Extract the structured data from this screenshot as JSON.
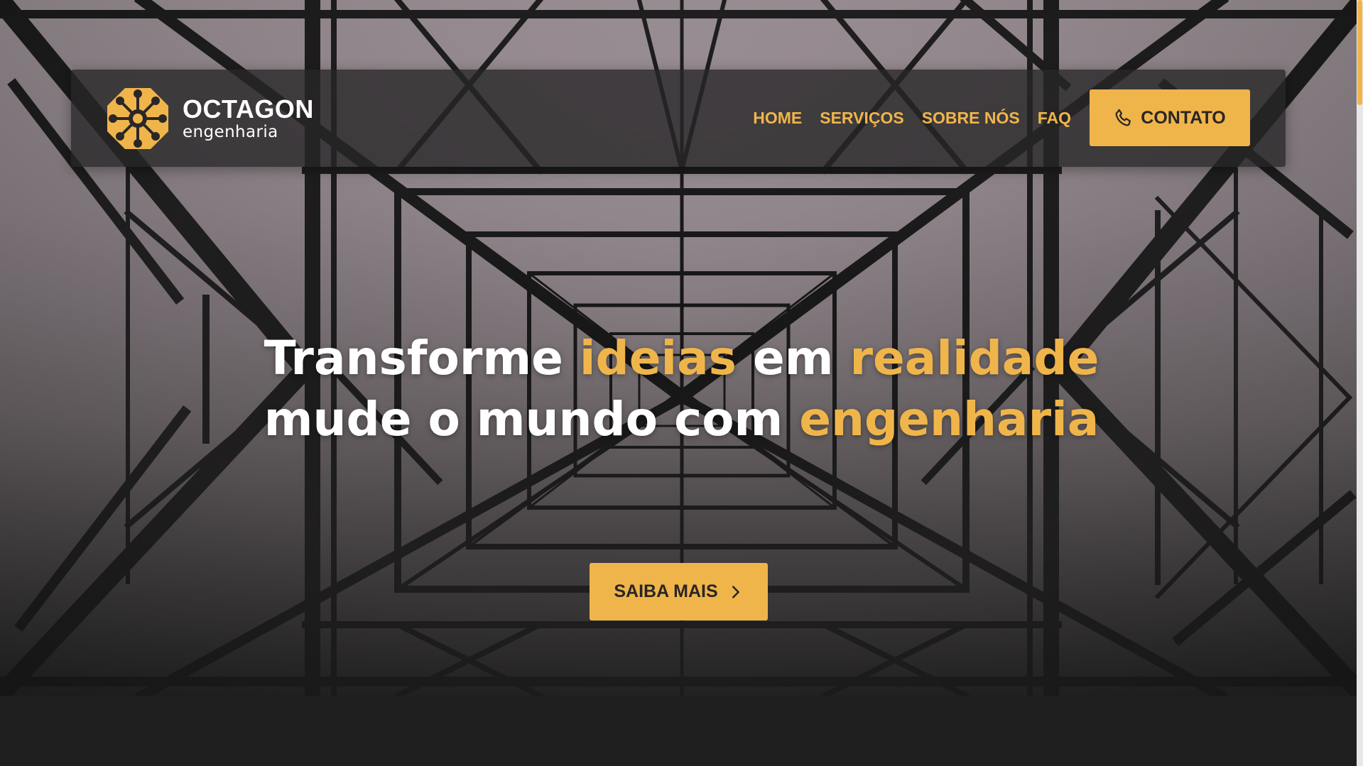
{
  "brand": {
    "name": "OCTAGON",
    "subtitle": "engenharia"
  },
  "nav": {
    "items": [
      {
        "label": "HOME"
      },
      {
        "label": "SERVIÇOS"
      },
      {
        "label": "SOBRE NÓS"
      },
      {
        "label": "FAQ"
      }
    ],
    "contact_label": "CONTATO"
  },
  "hero": {
    "line1": [
      {
        "text": "Transforme "
      },
      {
        "text": "ideias",
        "accent": true
      },
      {
        "text": " em "
      },
      {
        "text": "realidade",
        "accent": true
      }
    ],
    "line2": [
      {
        "text": "mude o mundo com "
      },
      {
        "text": "engenharia",
        "accent": true
      }
    ],
    "cta_label": "SAIBA MAIS"
  },
  "icons": {
    "logo": "octagon-gear-logo-icon",
    "contact": "phone-icon",
    "cta": "chevron-right-icon"
  },
  "colors": {
    "accent": "#f0b54a",
    "dark": "#2a2626",
    "navbar": "#282628",
    "footer": "#1f1f1f"
  }
}
